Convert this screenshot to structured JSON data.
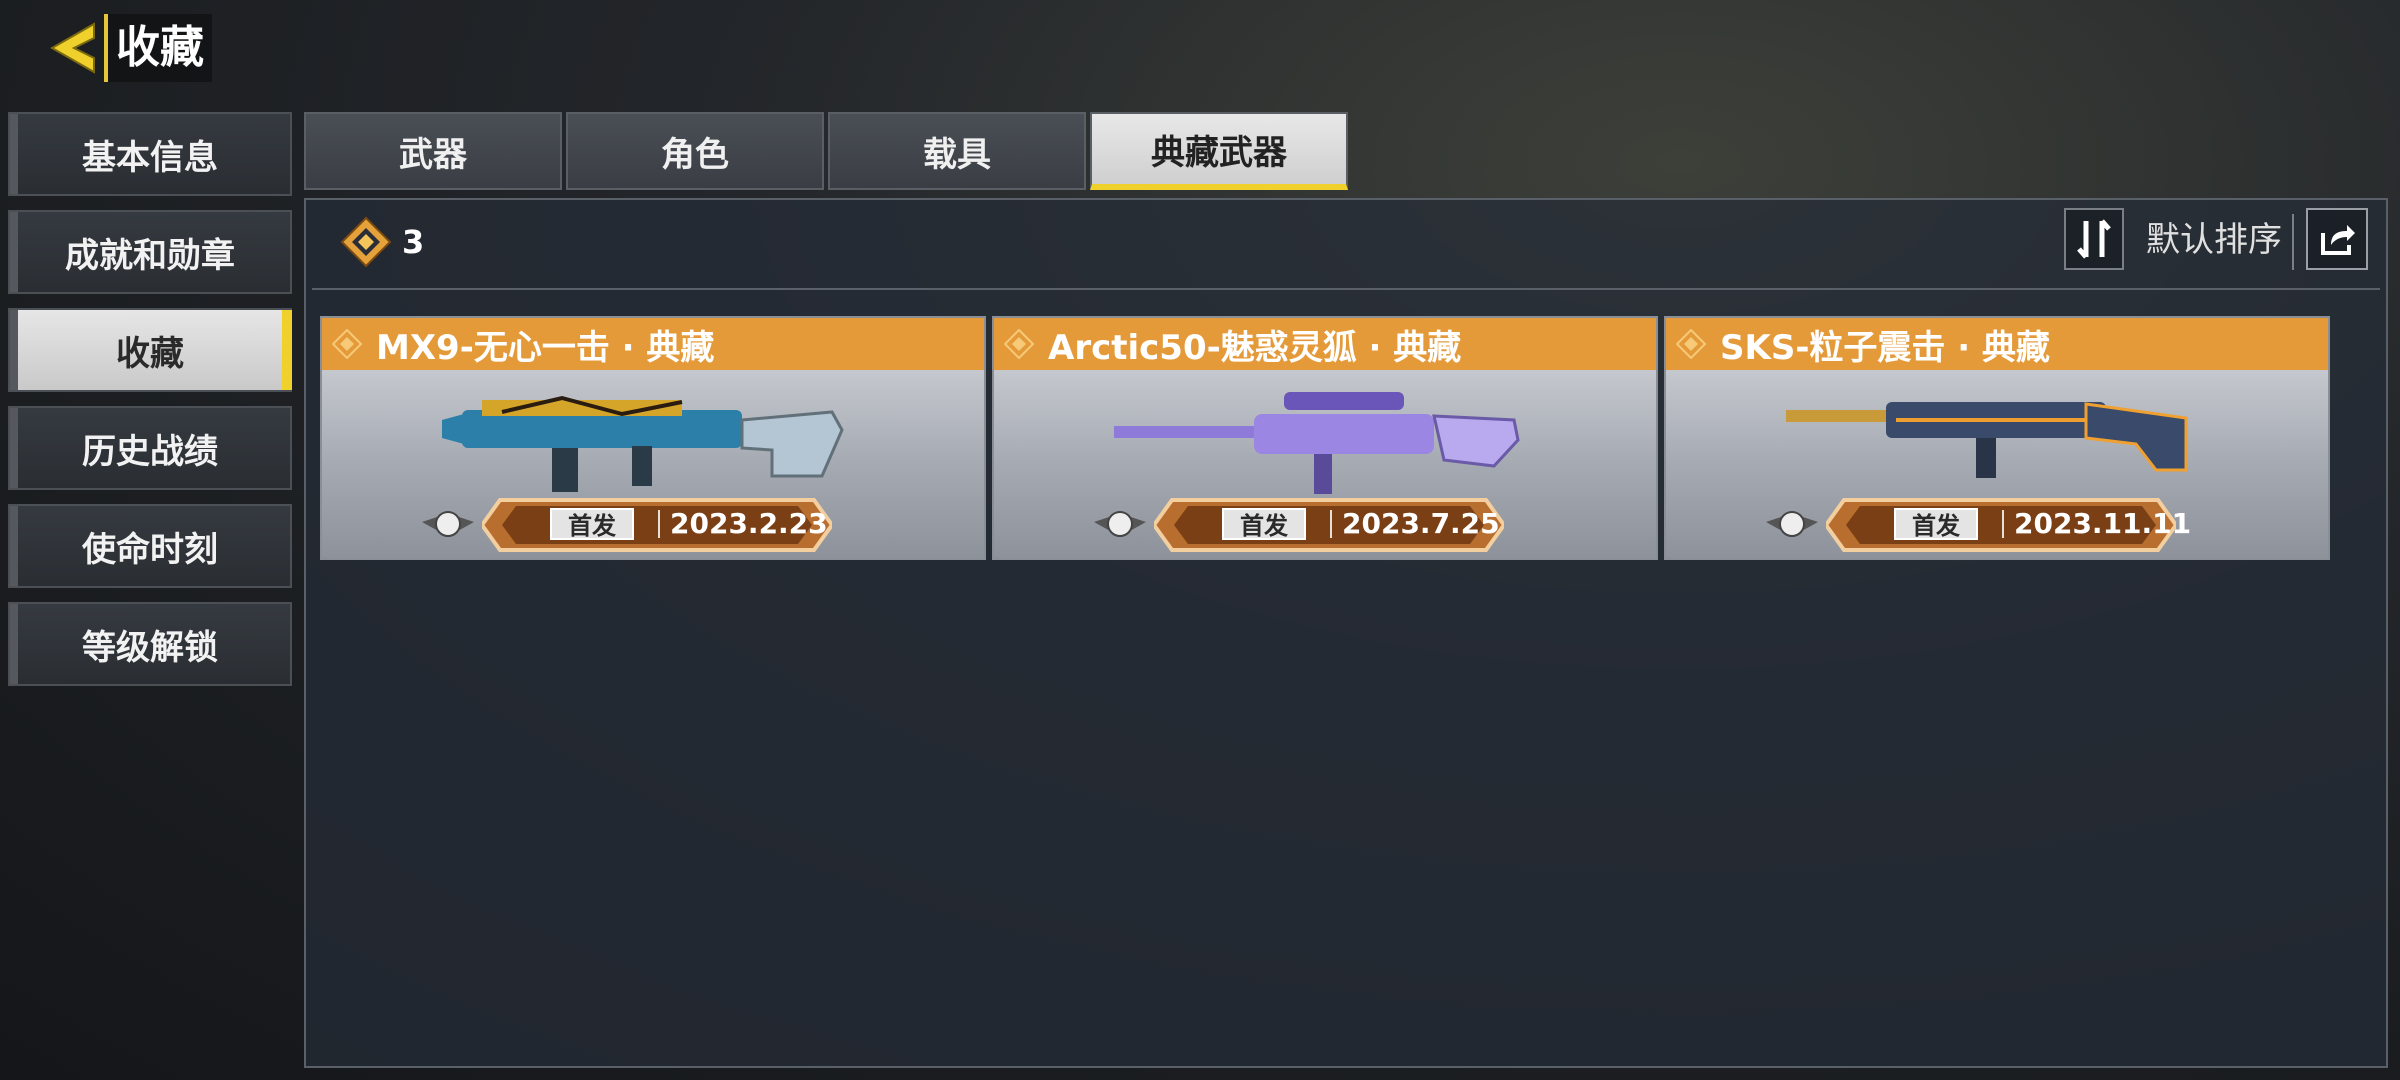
{
  "header": {
    "title": "收藏",
    "back_icon": "back-arrow-icon"
  },
  "sidebar": {
    "items": [
      {
        "label": "基本信息"
      },
      {
        "label": "成就和勋章"
      },
      {
        "label": "收藏",
        "active": true
      },
      {
        "label": "历史战绩"
      },
      {
        "label": "使命时刻"
      },
      {
        "label": "等级解锁"
      }
    ]
  },
  "tabs": [
    {
      "label": "武器"
    },
    {
      "label": "角色"
    },
    {
      "label": "载具"
    },
    {
      "label": "典藏武器",
      "active": true
    }
  ],
  "summary": {
    "count": "3",
    "icon": "collection-emblem-icon"
  },
  "sort": {
    "label": "默认排序",
    "toggle_icon": "sort-toggle-icon",
    "share_icon": "share-icon"
  },
  "cards": [
    {
      "name": "MX9-无心一击 · 典藏",
      "tag": "首发",
      "date": "2023.2.23"
    },
    {
      "name": "Arctic50-魅惑灵狐 · 典藏",
      "tag": "首发",
      "date": "2023.7.25"
    },
    {
      "name": "SKS-粒子震击 · 典藏",
      "tag": "首发",
      "date": "2023.11.11"
    }
  ],
  "colors": {
    "accent": "#f0d02a",
    "card_title": "#e59a3a",
    "panel": "#262c38"
  }
}
